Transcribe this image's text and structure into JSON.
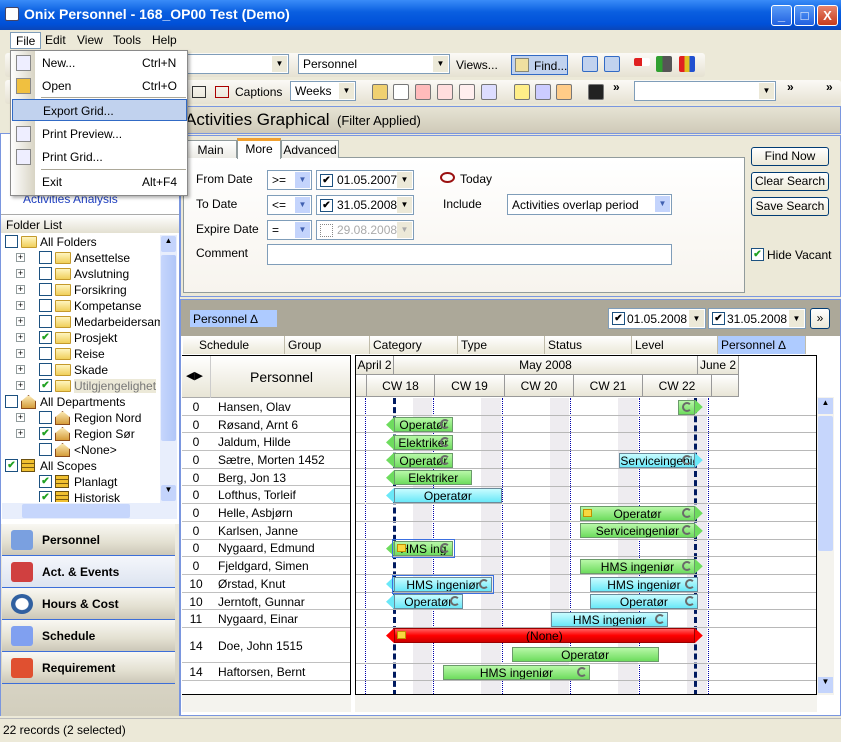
{
  "window": {
    "title": "Onix Personnel - 168_OP00 Test (Demo)",
    "buttons": [
      "_",
      "□",
      "X"
    ]
  },
  "menubar": [
    "File",
    "Edit",
    "View",
    "Tools",
    "Help"
  ],
  "file_menu": [
    {
      "label": "New...",
      "shortcut": "Ctrl+N",
      "icon": "new-document-icon"
    },
    {
      "label": "Open",
      "shortcut": "Ctrl+O",
      "icon": "open-folder-icon"
    },
    {
      "label": "Export Grid...",
      "shortcut": "",
      "highlighted": true
    },
    {
      "label": "Print Preview...",
      "shortcut": "",
      "icon": "print-preview-icon"
    },
    {
      "label": "Print Grid...",
      "shortcut": "",
      "icon": "printer-icon"
    },
    {
      "label": "Exit",
      "shortcut": "Alt+F4"
    }
  ],
  "toolbar1": {
    "view_combo": "Personnel",
    "views_label": "Views...",
    "find_label": "Find..."
  },
  "toolbar2": {
    "captions_label": "Captions",
    "period_combo": "Weeks",
    "more": "»"
  },
  "view_header": {
    "title": "Activities Graphical",
    "subtitle": "(Filter Applied)"
  },
  "left_panel": {
    "hidden_link": "Activities Analysis",
    "folder_list_title": "Folder List",
    "tree": [
      {
        "label": "All Folders",
        "level": 0,
        "checked": false,
        "icon": "folder"
      },
      {
        "label": "Ansettelse",
        "level": 1,
        "checked": false,
        "icon": "folder",
        "expander": true
      },
      {
        "label": "Avslutning",
        "level": 1,
        "checked": false,
        "icon": "folder",
        "expander": true
      },
      {
        "label": "Forsikring",
        "level": 1,
        "checked": false,
        "icon": "folder",
        "expander": true
      },
      {
        "label": "Kompetanse",
        "level": 1,
        "checked": false,
        "icon": "folder",
        "expander": true
      },
      {
        "label": "Medarbeidersamtale",
        "level": 1,
        "checked": false,
        "icon": "folder",
        "expander": true
      },
      {
        "label": "Prosjekt",
        "level": 1,
        "checked": true,
        "icon": "folder",
        "expander": true
      },
      {
        "label": "Reise",
        "level": 1,
        "checked": false,
        "icon": "folder",
        "expander": true
      },
      {
        "label": "Skade",
        "level": 1,
        "checked": false,
        "icon": "folder",
        "expander": true
      },
      {
        "label": "Utilgjengelighet",
        "level": 1,
        "checked": true,
        "icon": "folder",
        "expander": true,
        "selected": true
      },
      {
        "label": "All Departments",
        "level": 0,
        "checked": false,
        "icon": "house"
      },
      {
        "label": "Region Nord",
        "level": 1,
        "checked": false,
        "icon": "house",
        "expander": true
      },
      {
        "label": "Region Sør",
        "level": 1,
        "checked": true,
        "icon": "house",
        "expander": true
      },
      {
        "label": "<None>",
        "level": 1,
        "checked": false,
        "icon": "house"
      },
      {
        "label": "All Scopes",
        "level": 0,
        "checked": true,
        "icon": "list"
      },
      {
        "label": "Planlagt",
        "level": 1,
        "checked": true,
        "icon": "list"
      },
      {
        "label": "Historisk",
        "level": 1,
        "checked": true,
        "icon": "list"
      }
    ],
    "nav": [
      {
        "label": "Personnel",
        "icon": "personnel-card-icon"
      },
      {
        "label": "Act. & Events",
        "icon": "clipboard-check-icon",
        "active": true
      },
      {
        "label": "Hours & Cost",
        "icon": "clock-icon"
      },
      {
        "label": "Schedule",
        "icon": "calendar-icon"
      },
      {
        "label": "Requirement",
        "icon": "award-ribbon-icon"
      }
    ]
  },
  "filter": {
    "tabs": [
      "Main",
      "More",
      "Advanced"
    ],
    "active_tab": "More",
    "from_date": {
      "label": "From Date",
      "op": ">=",
      "checked": true,
      "value": "01.05.2007"
    },
    "to_date": {
      "label": "To Date",
      "op": "<=",
      "checked": true,
      "value": "31.05.2008"
    },
    "expire_date": {
      "label": "Expire Date",
      "op": "=",
      "checked": false,
      "value": "29.08.2008"
    },
    "comment": {
      "label": "Comment",
      "value": ""
    },
    "today_label": "Today",
    "include": {
      "label": "Include",
      "value": "Activities overlap period"
    },
    "buttons": {
      "find_now": "Find Now",
      "clear_search": "Clear Search",
      "save_search": "Save Search"
    },
    "hide_vacant": {
      "label": "Hide Vacant",
      "checked": true
    }
  },
  "grid": {
    "group_chip": "Personnel ∆",
    "range_from": "01.05.2008",
    "range_to": "31.05.2008",
    "range_next": "»",
    "columns": [
      "Schedule",
      "Group",
      "Category",
      "Type",
      "Status",
      "Level",
      "Personnel ∆"
    ],
    "personnel_header": "Personnel",
    "timeline": {
      "months": [
        "April 2",
        "May 2008",
        "June 2"
      ],
      "weeks": [
        "CW 18",
        "CW 19",
        "CW 20",
        "CW 21",
        "CW 22"
      ],
      "period_start": "2008-05-01",
      "period_end": "2008-05-31"
    },
    "colors": {
      "green": "#6edc5e",
      "cyan": "#6ae8f8",
      "red": "#ff0000"
    },
    "rows": [
      {
        "level": "0",
        "name": "Hansen, Olav",
        "bars": [
          {
            "text": "",
            "start": "2008-05-30",
            "end": "2008-05-31",
            "color": "green",
            "arrow_right": true,
            "cycle": true
          }
        ]
      },
      {
        "level": "0",
        "name": "Røsand, Arnt 6",
        "bars": [
          {
            "text": "Operatør",
            "start": "2008-05-01",
            "end": "2008-05-06",
            "color": "green",
            "arrow_left": true,
            "cycle": true
          }
        ]
      },
      {
        "level": "0",
        "name": "Jaldum, Hilde",
        "bars": [
          {
            "text": "Elektriker",
            "start": "2008-05-01",
            "end": "2008-05-06",
            "color": "green",
            "arrow_left": true,
            "cycle": true
          }
        ]
      },
      {
        "level": "0",
        "name": "Sætre, Morten 1452",
        "bars": [
          {
            "text": "Operatør",
            "start": "2008-05-01",
            "end": "2008-05-06",
            "color": "green",
            "arrow_left": true,
            "cycle": true
          },
          {
            "text": "Serviceingeniør",
            "start": "2008-05-24",
            "end": "2008-05-31",
            "color": "cyan",
            "arrow_right": true,
            "cycle": true
          }
        ]
      },
      {
        "level": "0",
        "name": "Berg, Jon 13",
        "bars": [
          {
            "text": "Elektriker",
            "start": "2008-05-01",
            "end": "2008-05-08",
            "color": "green",
            "arrow_left": true
          }
        ]
      },
      {
        "level": "0",
        "name": "Lofthus, Torleif",
        "bars": [
          {
            "text": "Operatør",
            "start": "2008-05-01",
            "end": "2008-05-11",
            "color": "cyan",
            "arrow_left": true
          }
        ]
      },
      {
        "level": "0",
        "name": "Helle, Asbjørn",
        "bars": [
          {
            "text": "Operatør",
            "start": "2008-05-20",
            "end": "2008-05-31",
            "color": "green",
            "arrow_right": true,
            "cycle": true,
            "note": true
          }
        ]
      },
      {
        "level": "0",
        "name": "Karlsen, Janne",
        "bars": [
          {
            "text": "Serviceingeniør",
            "start": "2008-05-20",
            "end": "2008-05-31",
            "color": "green",
            "arrow_right": true,
            "cycle": true
          }
        ]
      },
      {
        "level": "0",
        "name": "Nygaard, Edmund",
        "bars": [
          {
            "text": "HMS ing",
            "start": "2008-05-01",
            "end": "2008-05-06",
            "color": "green",
            "arrow_left": true,
            "cycle": true,
            "note": true,
            "selected": true
          }
        ]
      },
      {
        "level": "0",
        "name": "Fjeldgard, Simen",
        "bars": [
          {
            "text": "HMS ingeniør",
            "start": "2008-05-20",
            "end": "2008-05-31",
            "color": "green",
            "arrow_right": true,
            "cycle": true
          }
        ]
      },
      {
        "level": "10",
        "name": "Ørstad, Knut",
        "bars": [
          {
            "text": "HMS ingeniør",
            "start": "2008-05-01",
            "end": "2008-05-10",
            "color": "cyan",
            "arrow_left": true,
            "cycle": true,
            "selected": true
          },
          {
            "text": "HMS ingeniør",
            "start": "2008-05-21",
            "end": "2008-05-31",
            "color": "cyan",
            "cycle": true
          }
        ]
      },
      {
        "level": "10",
        "name": "Jerntoft, Gunnar",
        "bars": [
          {
            "text": "Operatør",
            "start": "2008-05-01",
            "end": "2008-05-07",
            "color": "cyan",
            "arrow_left": true,
            "cycle": true
          },
          {
            "text": "Operatør",
            "start": "2008-05-21",
            "end": "2008-05-31",
            "color": "cyan",
            "cycle": true
          }
        ]
      },
      {
        "level": "11",
        "name": "Nygaard, Einar",
        "bars": [
          {
            "text": "HMS ingeniør",
            "start": "2008-05-17",
            "end": "2008-05-28",
            "color": "cyan",
            "cycle": true
          }
        ]
      },
      {
        "level": "14",
        "name": "Doe, John 1515",
        "bars": [
          {
            "text": "(None)",
            "start": "2008-05-01",
            "end": "2008-05-31",
            "color": "red",
            "arrow_left": true,
            "arrow_right": true,
            "note": true,
            "lane": 0
          },
          {
            "text": "Operatør",
            "start": "2008-05-13",
            "end": "2008-05-27",
            "color": "green",
            "lane": 1
          }
        ]
      },
      {
        "level": "14",
        "name": "Haftorsen, Bernt",
        "bars": [
          {
            "text": "HMS ingeniør",
            "start": "2008-05-06",
            "end": "2008-05-20",
            "color": "green",
            "cycle": true
          }
        ]
      }
    ]
  },
  "status_bar": "22 records (2 selected)"
}
